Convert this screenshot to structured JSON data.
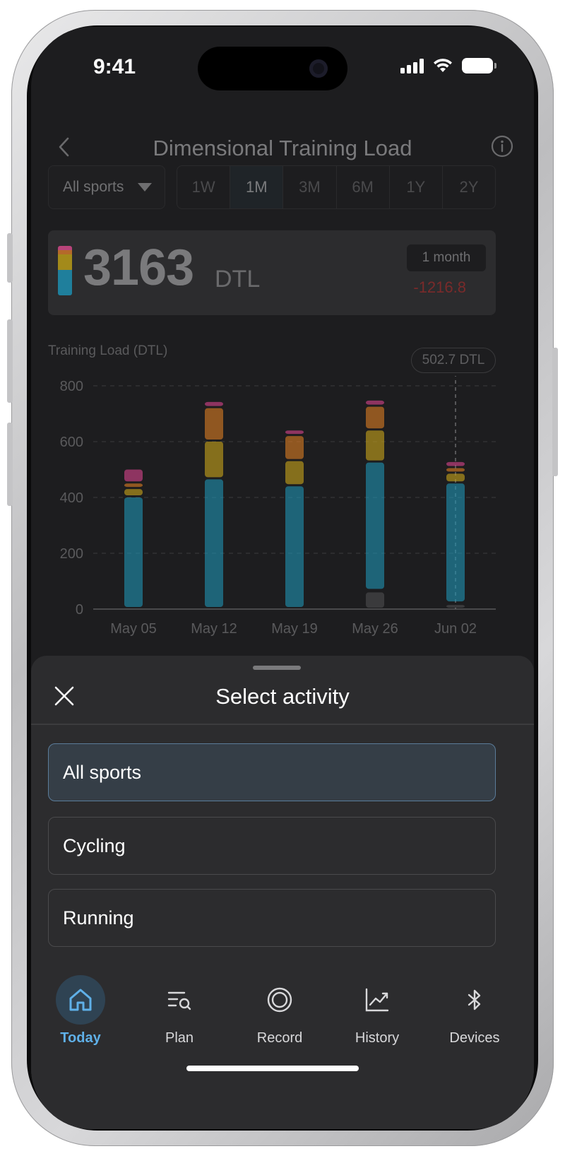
{
  "status_bar": {
    "time": "9:41"
  },
  "header": {
    "title": "Dimensional Training Load"
  },
  "filters": {
    "sport_selected": "All sports",
    "ranges": [
      "1W",
      "1M",
      "3M",
      "6M",
      "1Y",
      "2Y"
    ],
    "active_range": "1M"
  },
  "summary": {
    "value": "3163",
    "unit": "DTL",
    "period": "1 month",
    "delta": "-1216.8"
  },
  "chart_data": {
    "type": "bar",
    "title": "Training Load (DTL)",
    "xlabel": "",
    "ylabel": "",
    "ylim": [
      0,
      800
    ],
    "y_ticks": [
      "0",
      "200",
      "400",
      "600",
      "800"
    ],
    "categories": [
      "May 05",
      "May 12",
      "May 19",
      "May 26",
      "Jun 02"
    ],
    "stacked": true,
    "series": [
      {
        "color": "#1f8fb0",
        "values": [
          400,
          465,
          440,
          460,
          430
        ]
      },
      {
        "color": "#c5a21b",
        "values": [
          30,
          135,
          90,
          115,
          35
        ]
      },
      {
        "color": "#d67a24",
        "values": [
          20,
          120,
          90,
          85,
          20
        ]
      },
      {
        "color": "#d4428a",
        "values": [
          50,
          22,
          20,
          22,
          22
        ]
      }
    ],
    "selected_category": "Jun 02",
    "selected_label": "502.7 DTL",
    "colors": {
      "bottom_gray_segments": [
        0,
        0,
        0,
        65,
        20
      ]
    }
  },
  "sheet": {
    "title": "Select activity",
    "options": [
      "All sports",
      "Cycling",
      "Running"
    ],
    "selected": "All sports"
  },
  "tabbar": {
    "items": [
      {
        "label": "Today",
        "icon": "home-icon",
        "active": true
      },
      {
        "label": "Plan",
        "icon": "plan-search-icon",
        "active": false
      },
      {
        "label": "Record",
        "icon": "record-icon",
        "active": false
      },
      {
        "label": "History",
        "icon": "chart-line-icon",
        "active": false
      },
      {
        "label": "Devices",
        "icon": "bluetooth-icon",
        "active": false
      }
    ],
    "accent": "#5fb0e8"
  }
}
